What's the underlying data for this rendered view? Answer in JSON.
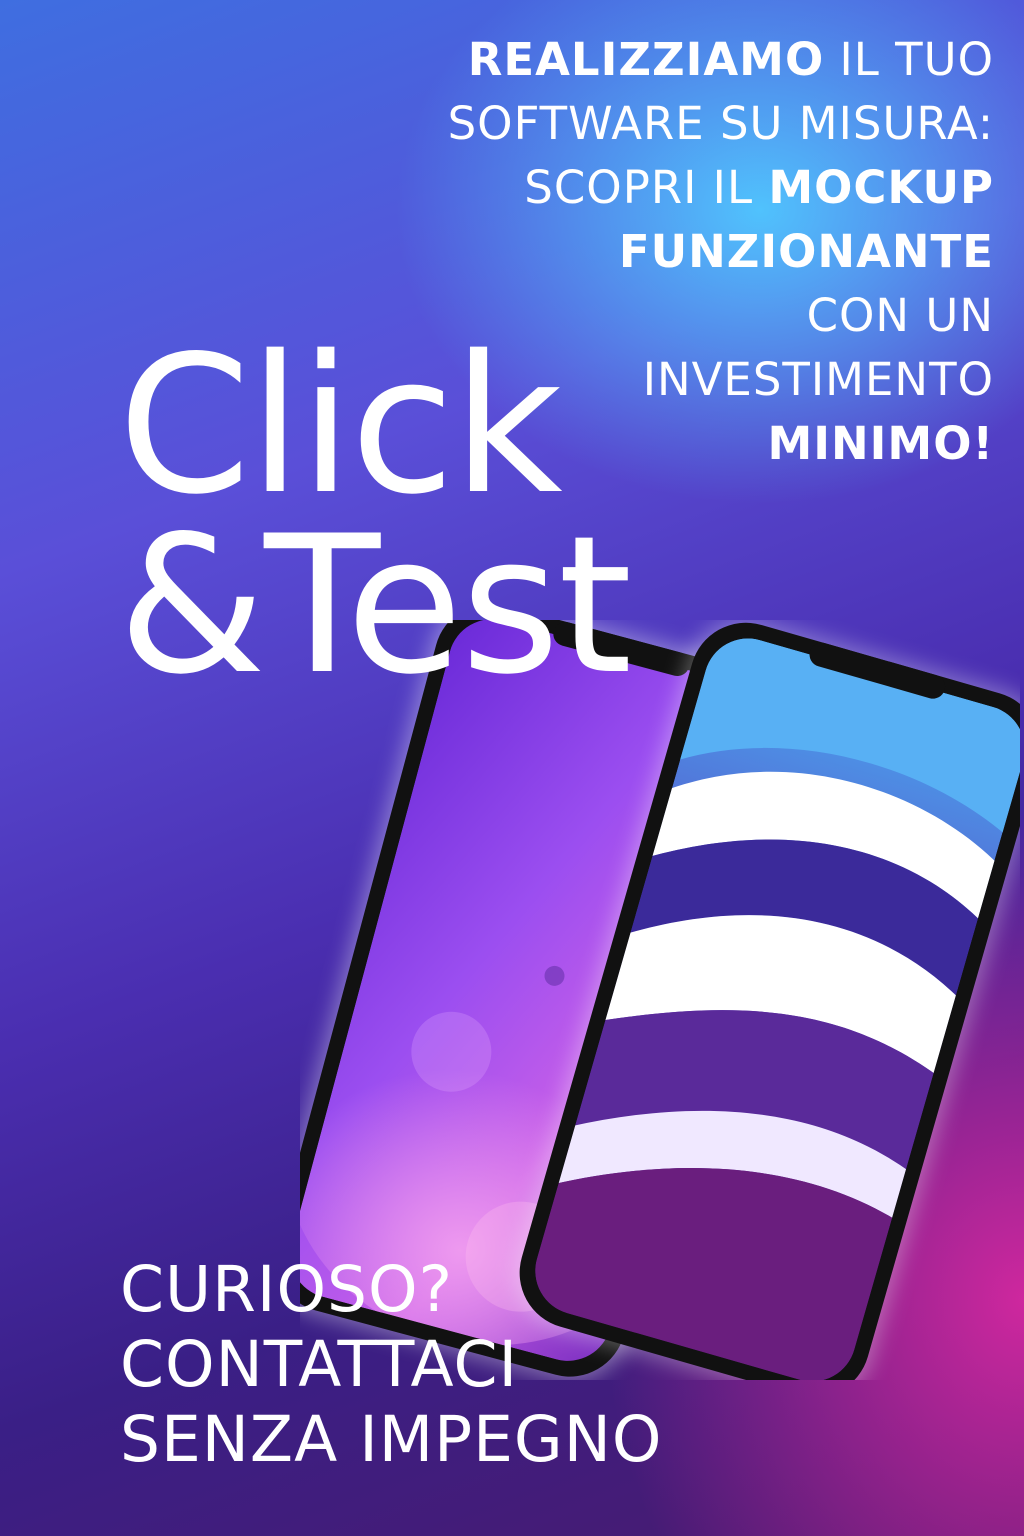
{
  "tagline": {
    "line1_bold": "REALIZZIAMO",
    "line1_rest": " IL TUO",
    "line2": "SOFTWARE SU MISURA:",
    "line3_light": "SCOPRI IL ",
    "line3_bold": "MOCKUP",
    "line4": "FUNZIONANTE",
    "line5": "CON UN",
    "line6": "INVESTIMENTO",
    "line7": "MINIMO!"
  },
  "brand": {
    "line1": "Click",
    "line2": "&Test"
  },
  "cta": {
    "line1": "CURIOSO?",
    "line2": "CONTATTACI",
    "line3": "SENZA IMPEGNO"
  },
  "colors": {
    "sky": "#50c8ff",
    "violet": "#4a2eb0",
    "magenta": "#d628a0"
  }
}
